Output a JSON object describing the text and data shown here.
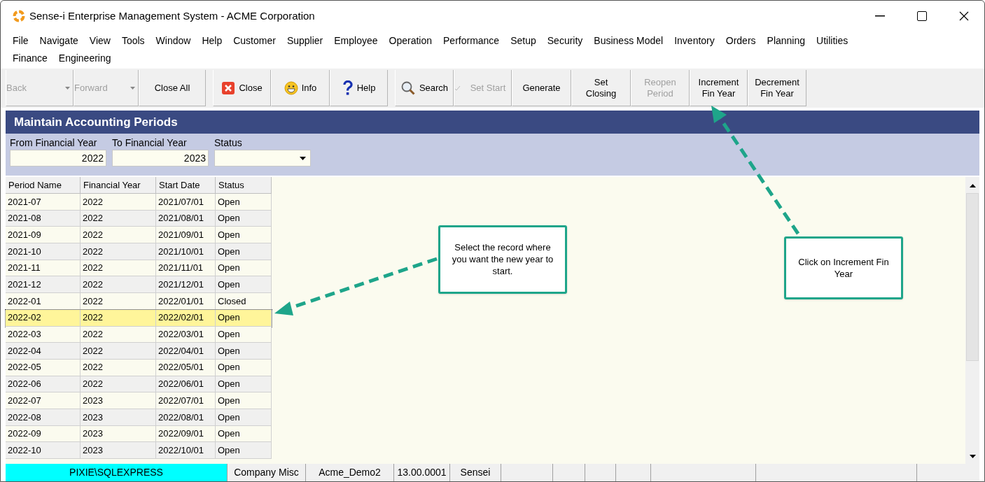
{
  "window": {
    "title": "Sense-i Enterprise Management System - ACME Corporation"
  },
  "menu_rows": [
    [
      "File",
      "Navigate",
      "View",
      "Tools",
      "Window",
      "Help",
      "Customer",
      "Supplier",
      "Employee",
      "Operation",
      "Performance",
      "Setup",
      "Security",
      "Business Model",
      "Inventory",
      "Orders",
      "Planning",
      "Utilities"
    ],
    [
      "Finance",
      "Engineering"
    ]
  ],
  "toolbar_groups": [
    [
      {
        "kind": "dropdown",
        "label": "Back",
        "disabled": true
      },
      {
        "kind": "dropdown",
        "label": "Forward",
        "disabled": true
      },
      {
        "kind": "plain",
        "label": "Close All",
        "disabled": false
      }
    ],
    [
      {
        "kind": "close",
        "label": "Close",
        "disabled": false
      },
      {
        "kind": "info",
        "label": "Info",
        "disabled": false
      },
      {
        "kind": "help",
        "label": "Help",
        "disabled": false
      }
    ],
    [
      {
        "kind": "search",
        "label": "Search",
        "disabled": false
      },
      {
        "kind": "tick",
        "label": "Set Start",
        "disabled": true
      },
      {
        "kind": "plain",
        "label": "Generate",
        "disabled": false
      },
      {
        "kind": "plain",
        "label": "Set Closing",
        "disabled": false
      },
      {
        "kind": "plain",
        "label": "Reopen Period",
        "disabled": true
      },
      {
        "kind": "plain",
        "label": "Increment Fin Year",
        "disabled": false
      },
      {
        "kind": "plain",
        "label": "Decrement Fin Year",
        "disabled": false
      }
    ]
  ],
  "form_title": "Maintain Accounting Periods",
  "filters": [
    {
      "label": "From Financial Year",
      "value": "2022",
      "kind": "text"
    },
    {
      "label": "To Financial Year",
      "value": "2023",
      "kind": "text"
    },
    {
      "label": "Status",
      "kind": "select"
    }
  ],
  "table": {
    "columns": [
      "Period Name",
      "Financial Year",
      "Start Date",
      "Status"
    ],
    "rows": [
      {
        "cells": [
          "2021-07",
          "2022",
          "2021/07/01",
          "Open"
        ],
        "selected": false
      },
      {
        "cells": [
          "2021-08",
          "2022",
          "2021/08/01",
          "Open"
        ],
        "selected": false
      },
      {
        "cells": [
          "2021-09",
          "2022",
          "2021/09/01",
          "Open"
        ],
        "selected": false
      },
      {
        "cells": [
          "2021-10",
          "2022",
          "2021/10/01",
          "Open"
        ],
        "selected": false
      },
      {
        "cells": [
          "2021-11",
          "2022",
          "2021/11/01",
          "Open"
        ],
        "selected": false
      },
      {
        "cells": [
          "2021-12",
          "2022",
          "2021/12/01",
          "Open"
        ],
        "selected": false
      },
      {
        "cells": [
          "2022-01",
          "2022",
          "2022/01/01",
          "Closed"
        ],
        "selected": false
      },
      {
        "cells": [
          "2022-02",
          "2022",
          "2022/02/01",
          "Open"
        ],
        "selected": true
      },
      {
        "cells": [
          "2022-03",
          "2022",
          "2022/03/01",
          "Open"
        ],
        "selected": false
      },
      {
        "cells": [
          "2022-04",
          "2022",
          "2022/04/01",
          "Open"
        ],
        "selected": false
      },
      {
        "cells": [
          "2022-05",
          "2022",
          "2022/05/01",
          "Open"
        ],
        "selected": false
      },
      {
        "cells": [
          "2022-06",
          "2022",
          "2022/06/01",
          "Open"
        ],
        "selected": false
      },
      {
        "cells": [
          "2022-07",
          "2023",
          "2022/07/01",
          "Open"
        ],
        "selected": false
      },
      {
        "cells": [
          "2022-08",
          "2023",
          "2022/08/01",
          "Open"
        ],
        "selected": false
      },
      {
        "cells": [
          "2022-09",
          "2023",
          "2022/09/01",
          "Open"
        ],
        "selected": false
      },
      {
        "cells": [
          "2022-10",
          "2023",
          "2022/10/01",
          "Open"
        ],
        "selected": false
      }
    ]
  },
  "callouts": [
    "Select the record where you want the new year to start.",
    "Click on Increment Fin Year"
  ],
  "status_bar": [
    {
      "text": "PIXIE\\SQLEXPRESS",
      "highlight": true
    },
    {
      "text": "Company Misc",
      "highlight": false
    },
    {
      "text": "Acme_Demo2",
      "highlight": false
    },
    {
      "text": "13.00.0001",
      "highlight": false
    },
    {
      "text": "Sensei",
      "highlight": false
    }
  ]
}
